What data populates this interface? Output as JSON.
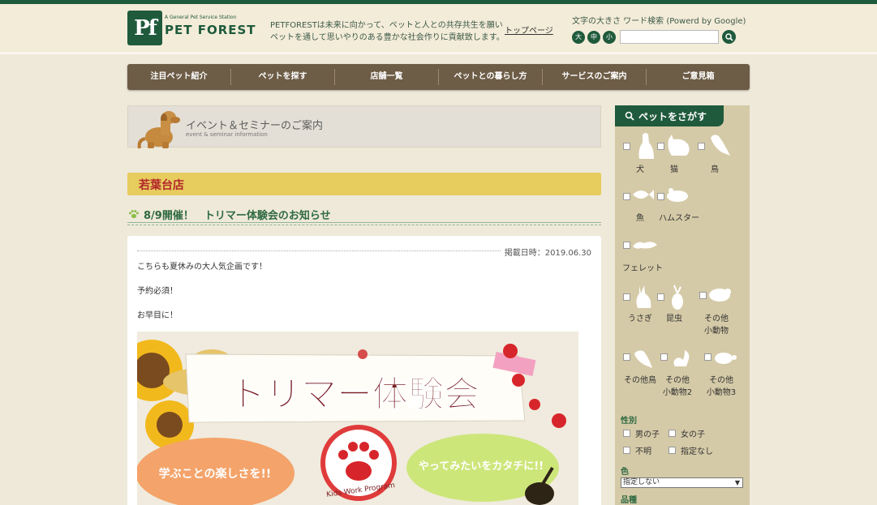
{
  "header": {
    "logo_mark": "Pf",
    "logo_sub": "A General Pet Service Station",
    "logo_name": "PET FOREST",
    "tagline": "PETFORESTは未来に向かって、ペットと人との共存共生を願いペットを通して思いやりのある豊かな社会作りに貢献致します。",
    "top_link": "トップページ",
    "tools_label": "文字の大きさ ワード検索 (Powerd by Google)",
    "size_large": "大",
    "size_medium": "中",
    "size_small": "小",
    "search_value": ""
  },
  "nav": {
    "items": [
      "注目ペット紹介",
      "ペットを探す",
      "店舗一覧",
      "ペットとの暮らし方",
      "サービスのご案内",
      "ご意見箱"
    ]
  },
  "banner": {
    "title": "イベント＆セミナーのご案内",
    "subtitle": "event & seminar information"
  },
  "store": {
    "name": "若葉台店"
  },
  "article": {
    "title": "8/9開催！　トリマー体験会のお知らせ",
    "date": "掲載日時：2019.06.30",
    "lines": [
      "こちらも夏休みの大人気企画です！",
      "予約必須！",
      "お早目に！"
    ],
    "promo": {
      "headline": "トリマー体験会",
      "bubble_left": "学ぶことの楽しさを!!",
      "bubble_right": "やってみたいをカタチに!!",
      "program": "Kids Work Program"
    }
  },
  "sidebar": {
    "header": "ペットをさがす",
    "animals": [
      "犬",
      "猫",
      "鳥",
      "魚",
      "ハムスター",
      "フェレット",
      "うさぎ",
      "昆虫",
      "その他\n小動物",
      "その他鳥",
      "その他\n小動物2",
      "その他\n小動物3"
    ],
    "sex_title": "性別",
    "sex_options": [
      "男の子",
      "女の子",
      "不明",
      "指定なし"
    ],
    "color_title": "色",
    "color_value": "指定しない",
    "breed_title": "品種"
  }
}
